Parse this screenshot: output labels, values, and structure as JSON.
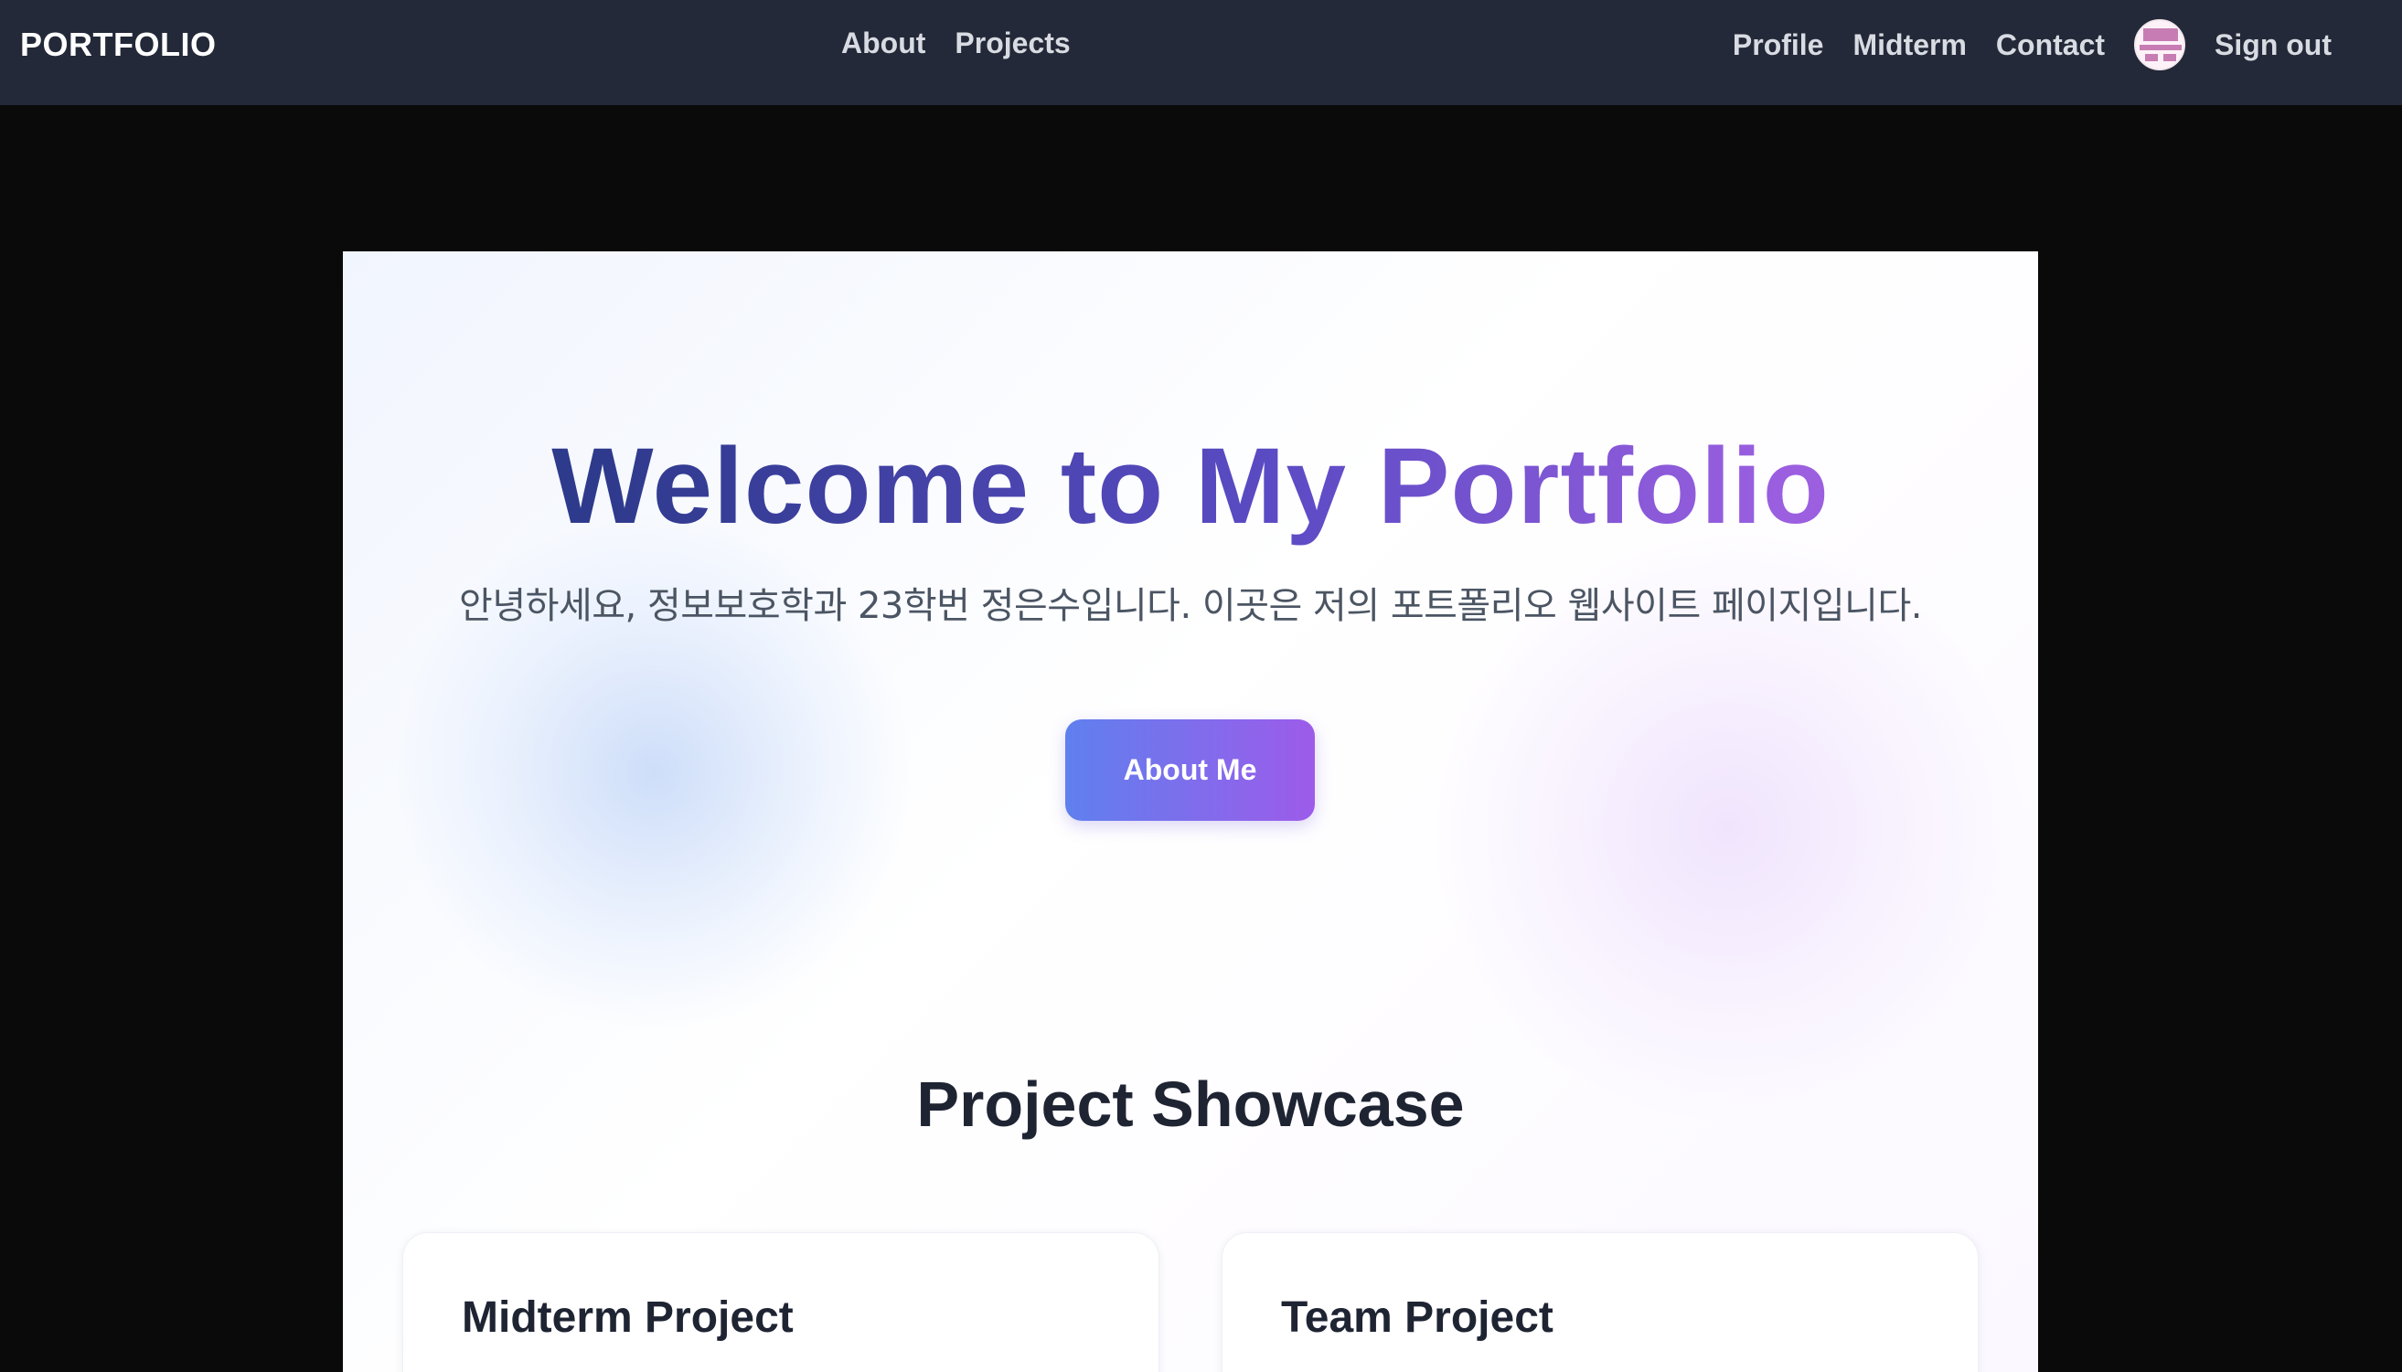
{
  "navbar": {
    "brand": "PORTFOLIO",
    "center_links": [
      "About",
      "Projects"
    ],
    "right_links": [
      "Profile",
      "Midterm",
      "Contact"
    ],
    "avatar_icon": "user-avatar-icon",
    "sign_out": "Sign out"
  },
  "hero": {
    "title": "Welcome to My Portfolio",
    "subtitle": "안녕하세요, 정보보호학과 23학번 정은수입니다. 이곳은 저의 포트폴리오 웹사이트 페이지입니다.",
    "button_label": "About Me"
  },
  "showcase": {
    "title": "Project Showcase",
    "cards": [
      {
        "title": "Midterm Project"
      },
      {
        "title": "Team Project"
      }
    ]
  },
  "colors": {
    "navbar_bg": "#232938",
    "page_bg": "#0a0a0a",
    "accent_start": "#5f80ee",
    "accent_end": "#9d5bea",
    "title_dark": "#2e3a8c",
    "title_light": "#9b5fe0"
  }
}
